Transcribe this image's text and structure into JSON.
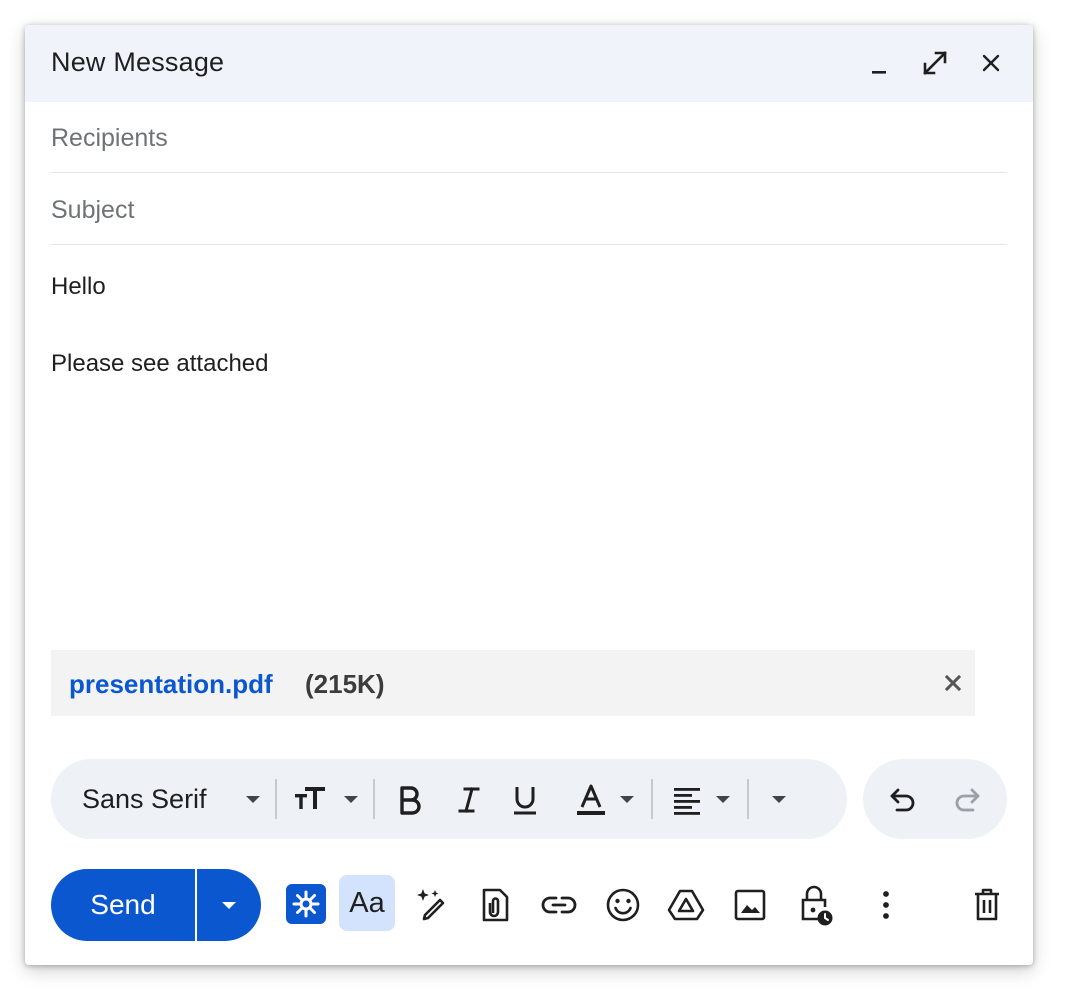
{
  "window": {
    "title": "New Message"
  },
  "fields": {
    "recipients_placeholder": "Recipients",
    "subject_placeholder": "Subject"
  },
  "body": {
    "lines": [
      "Hello",
      "Please see attached"
    ]
  },
  "attachment": {
    "filename": "presentation.pdf",
    "size": "(215K)"
  },
  "format_toolbar": {
    "font_name": "Sans Serif",
    "icons": [
      "font-family-dropdown-icon",
      "text-size-icon",
      "bold-icon",
      "italic-icon",
      "underline-icon",
      "text-color-icon",
      "align-icon",
      "more-formatting-icon"
    ]
  },
  "history_toolbar": {
    "icons": [
      "undo-icon",
      "redo-icon"
    ]
  },
  "actions": {
    "send_label": "Send",
    "format_button_label": "Aa",
    "icons": [
      "gemini-icon",
      "help-me-write-icon",
      "attach-file-icon",
      "insert-link-icon",
      "emoji-icon",
      "google-drive-icon",
      "insert-photo-icon",
      "confidential-mode-icon",
      "more-options-icon",
      "discard-draft-icon"
    ]
  },
  "colors": {
    "accent": "#0b57d0",
    "header_bg": "#f0f4fa",
    "toolbar_bg": "#eef1f6",
    "format_button_bg": "#d3e3fd"
  }
}
